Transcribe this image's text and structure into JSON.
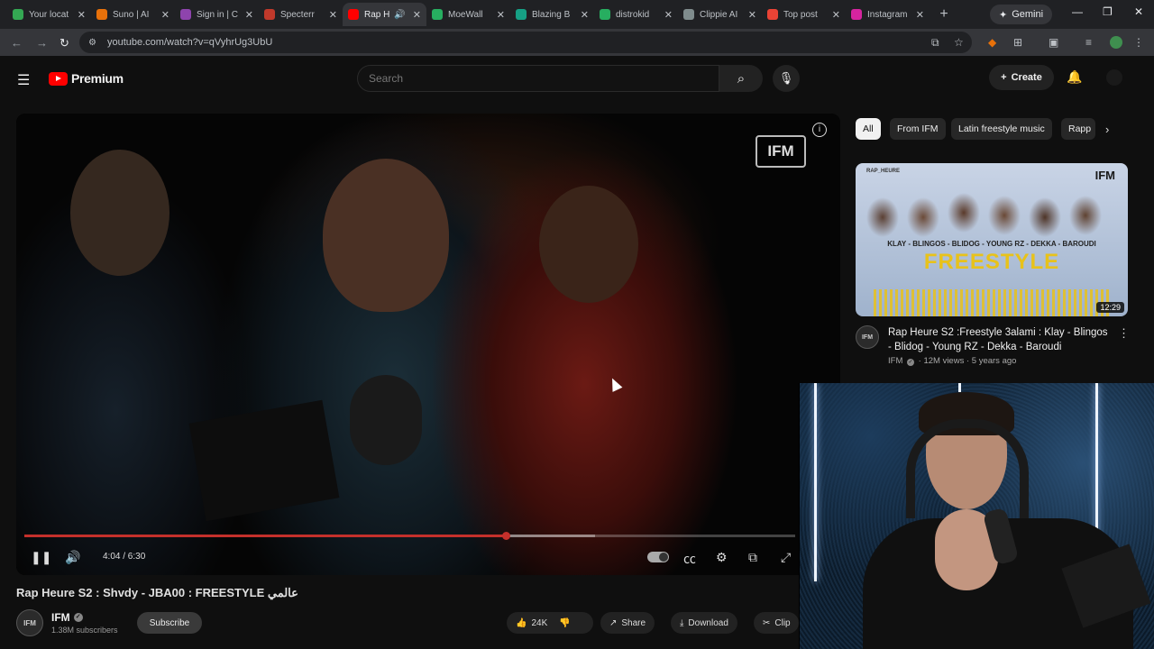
{
  "browser": {
    "tabs": [
      {
        "label": "Your locat",
        "color": "#34a853",
        "active": false
      },
      {
        "label": "Suno | AI",
        "color": "#e8710a",
        "active": false
      },
      {
        "label": "Sign in | C",
        "color": "#8e44ad",
        "active": false
      },
      {
        "label": "Specterr",
        "color": "#c0392b",
        "active": false
      },
      {
        "label": "Rap H",
        "color": "#ff0000",
        "active": true
      },
      {
        "label": "MoeWall",
        "color": "#27ae60",
        "active": false
      },
      {
        "label": "Blazing B",
        "color": "#16a085",
        "active": false
      },
      {
        "label": "distrokid",
        "color": "#27ae60",
        "active": false
      },
      {
        "label": "Clippie AI",
        "color": "#7f8c8d",
        "active": false
      },
      {
        "label": "Top post",
        "color": "#ea4335",
        "active": false
      },
      {
        "label": "Instagram",
        "color": "#d6249f",
        "active": false
      }
    ],
    "gemini_label": "Gemini",
    "url": "youtube.com/watch?v=qVyhrUg3UbU"
  },
  "header": {
    "brand": "Premium",
    "search_placeholder": "Search",
    "create_label": "Create"
  },
  "player": {
    "watermark": "IFM",
    "time": "4:04 / 6:30",
    "progress_played": 0.624,
    "progress_buffered": 0.74
  },
  "video": {
    "title": "Rap Heure S2 : Shvdy - JBA00 : FREESTYLE عالمي",
    "channel": "IFM",
    "avatar_text": "IFM",
    "subscribers": "1.38M subscribers",
    "subscribe_label": "Subscribe",
    "likes": "24K",
    "share_label": "Share",
    "download_label": "Download",
    "clip_label": "Clip"
  },
  "filters": {
    "chips": [
      "All",
      "From IFM",
      "Latin freestyle music",
      "Rapp"
    ]
  },
  "recommended": {
    "thumb_brand": "RAP_HEURE",
    "thumb_logo": "IFM",
    "thumb_names": "KLAY - BLINGOS - BLIDOG - YOUNG RZ - DEKKA - BAROUDI",
    "thumb_word": "FREESTYLE",
    "duration": "12:29",
    "title": "Rap Heure S2 :Freestyle 3alami : Klay - Blingos - Blidog - Young RZ - Dekka - Baroudi",
    "channel": "IFM",
    "views": "12M views",
    "age": "5 years ago",
    "avatar_text": "IFM"
  }
}
